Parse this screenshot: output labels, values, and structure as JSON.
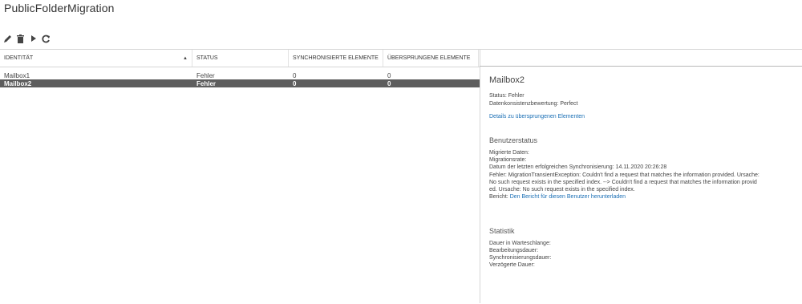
{
  "title": "PublicFolderMigration",
  "toolbar": {
    "edit_icon": "pencil-icon",
    "delete_icon": "trash-icon",
    "resume_icon": "play-icon",
    "refresh_icon": "refresh-icon"
  },
  "grid": {
    "columns": [
      "IDENTITÄT",
      "STATUS",
      "SYNCHRONISIERTE ELEMENTE",
      "ÜBERSPRUNGENE ELEMENTE"
    ],
    "sort": "identitaet-ascending",
    "rows": [
      {
        "identity": "Mailbox1",
        "status": "Fehler",
        "synced": "0",
        "skipped": "0",
        "selected": false
      },
      {
        "identity": "Mailbox2",
        "status": "Fehler",
        "synced": "0",
        "skipped": "0",
        "selected": true
      }
    ]
  },
  "details": {
    "title": "Mailbox2",
    "status": "Status: Fehler",
    "consistency": "Datenkonsistenzbewertung: Perfect",
    "skipped_link": "Details zu übersprungenen Elementen",
    "user_status_heading": "Benutzerstatus",
    "migrated_data": "Migrierte Daten:",
    "migration_rate": "Migrationsrate:",
    "last_sync": "Datum der letzten erfolgreichen Synchronisierung: 14.11.2020 20:26:28",
    "error_line1": "Fehler: MigrationTransientException: Couldn't find a request that matches the information provided. Ursache:",
    "error_line2": "No such request exists in the specified index. --> Couldn't find a request that matches the information provid",
    "error_line3": "ed. Ursache: No such request exists in the specified index.",
    "report_label": "Bericht:",
    "report_link": "Den Bericht für diesen Benutzer herunterladen",
    "stats_heading": "Statistik",
    "queue_duration": "Dauer in Warteschlange:",
    "processing_duration": "Bearbeitungsdauer:",
    "sync_duration": "Synchronisierungsdauer:",
    "delayed_duration": "Verzögerte Dauer:"
  }
}
